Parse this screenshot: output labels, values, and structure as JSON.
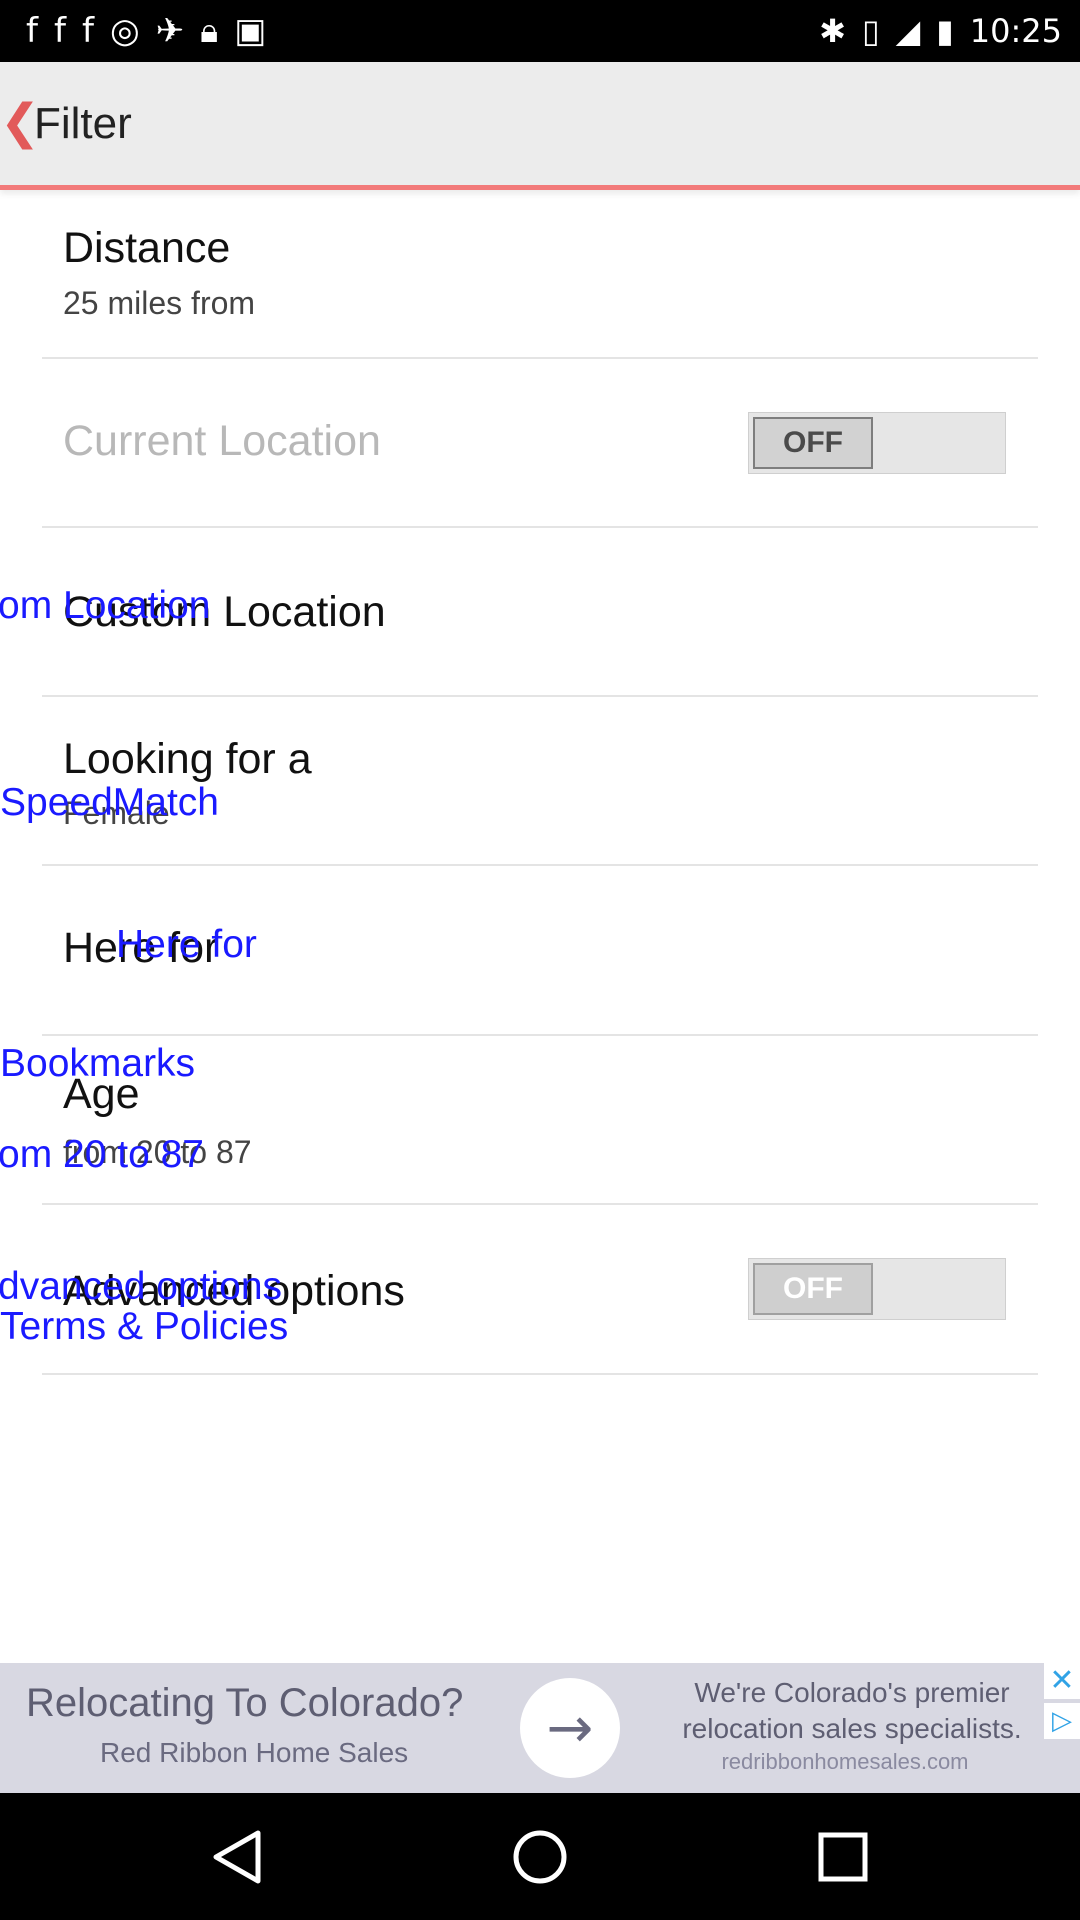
{
  "status_bar": {
    "time": "10:25",
    "left_icons": [
      "facebook-icon",
      "facebook-icon",
      "facebook-icon",
      "circle-icon",
      "fake-gps-icon",
      "lock-icon",
      "android-icon"
    ],
    "right_icons": [
      "bluetooth-icon",
      "vibrate-icon",
      "signal-icon",
      "battery-icon"
    ]
  },
  "header": {
    "title": "Filter"
  },
  "rows": {
    "distance": {
      "title": "Distance",
      "subtitle": "25 miles from"
    },
    "current_location": {
      "title": "Current Location",
      "toggle": "OFF"
    },
    "custom_location": {
      "title": "Custom Location"
    },
    "looking_for": {
      "title": "Looking for a",
      "subtitle": "Female"
    },
    "here_for": {
      "title": "Here for"
    },
    "age": {
      "title": "Age",
      "subtitle": "from 20 to 87"
    },
    "advanced": {
      "title": "Advanced options",
      "toggle": "OFF"
    }
  },
  "overlay_labels": {
    "custom_location": "om Location",
    "speedmatch": "SpeedMatch",
    "here_for": "Here for",
    "bookmarks": "Bookmarks",
    "age_range": "om 20 to 87",
    "advanced": "dvanced options",
    "terms": "Terms & Policies"
  },
  "ad": {
    "headline": "Relocating To Colorado?",
    "advertiser": "Red Ribbon Home Sales",
    "description": "We're Colorado's premier relocation sales specialists.",
    "url": "redribbonhomesales.com"
  },
  "colors": {
    "accent": "#f27a7a",
    "overlay_text": "#1a1aff"
  }
}
